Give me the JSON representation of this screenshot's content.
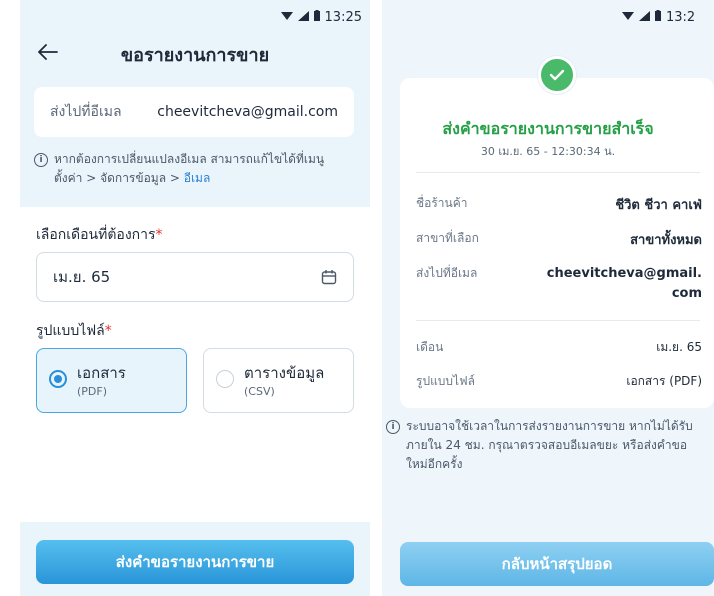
{
  "left_screen": {
    "status": {
      "time": "13:25"
    },
    "title": "ขอรายงานการขาย",
    "email_card": {
      "label": "ส่งไปที่อีเมล",
      "value": "cheevitcheva@gmail.com"
    },
    "info": {
      "line1": "หากต้องการเปลี่ยนแปลงอีเมล สามารถแก้ไขได้ที่เมนู",
      "line2_prefix": "ตั้งค่า > จัดการข้อมูล > ",
      "line2_link": "อีเมล"
    },
    "month_label": "เลือกเดือนที่ต้องการ",
    "month_value": "เม.ย. 65",
    "format_label": "รูปแบบไฟล์",
    "required_mark": "*",
    "options": [
      {
        "title": "เอกสาร",
        "sub": "(PDF)",
        "selected": true
      },
      {
        "title": "ตารางข้อมูล",
        "sub": "(CSV)",
        "selected": false
      }
    ],
    "submit_label": "ส่งคำขอรายงานการขาย"
  },
  "right_screen": {
    "status": {
      "time": "13:2"
    },
    "success_title": "ส่งคำขอรายงานการขายสำเร็จ",
    "success_date": "30 เม.ย. 65 - 12:30:34 น.",
    "rows": [
      {
        "key": "ชื่อร้านค้า",
        "value": "ชีวิต ชีวา คาเฟ่"
      },
      {
        "key": "สาขาที่เลือก",
        "value": "สาขาทั้งหมด"
      },
      {
        "key": "ส่งไปที่อีเมล",
        "value_line1": "cheevitcheva@gmail.",
        "value_line2": "com"
      },
      {
        "key": "เดือน",
        "value": "เม.ย. 65"
      },
      {
        "key": "รูปแบบไฟล์",
        "value": "เอกสาร (PDF)"
      }
    ],
    "note": {
      "line1": "ระบบอาจใช้เวลาในการส่งรายงานการขาย หากไม่ได้รับ",
      "line2": "ภายใน 24 ชม. กรุณาตรวจสอบอีเมลขยะ หรือส่งคำขอ",
      "line3": "ใหม่อีกครั้ง"
    },
    "back_label": "กลับหน้าสรุปยอด"
  },
  "colors": {
    "accent": "#2a95d8",
    "success": "#25a046",
    "required": "#e23434",
    "screen_bg": "#eaf4fb"
  },
  "icons": [
    "back-arrow-icon",
    "calendar-icon",
    "info-icon",
    "check-icon",
    "wifi-icon",
    "signal-icon",
    "battery-icon"
  ]
}
